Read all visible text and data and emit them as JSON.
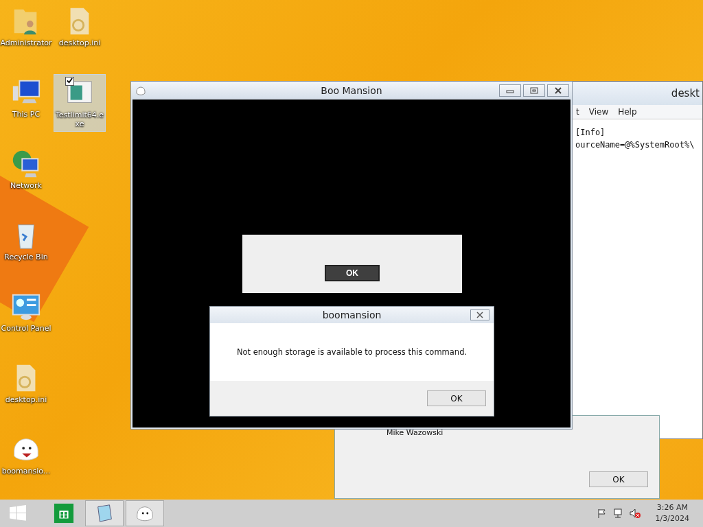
{
  "desktop_icons": [
    {
      "label": "Administrator",
      "kind": "user-folder",
      "selected": false
    },
    {
      "label": "This PC",
      "kind": "computer",
      "selected": false
    },
    {
      "label": "Network",
      "kind": "network",
      "selected": false
    },
    {
      "label": "Recycle Bin",
      "kind": "recycle",
      "selected": false
    },
    {
      "label": "Control Panel",
      "kind": "control",
      "selected": false
    },
    {
      "label": "desktop.ini",
      "kind": "settings-file",
      "selected": false
    },
    {
      "label": "boomansio...",
      "kind": "ghost",
      "selected": false
    },
    {
      "label": "desktop.ini",
      "kind": "settings-file",
      "selected": false
    },
    {
      "label": "Testlimit64.exe",
      "kind": "app",
      "selected": true,
      "checked": true
    }
  ],
  "notepad": {
    "title": "deskt",
    "menu": [
      "t",
      "View",
      "Help"
    ],
    "lines": [
      "[Info]",
      "ourceName=@%SystemRoot%\\"
    ]
  },
  "back_dialog": {
    "text": "Mike Wazowski",
    "button": "OK"
  },
  "game_window": {
    "title": "Boo Mansion",
    "dialog_button": "OK"
  },
  "message_box": {
    "title": "boomansion",
    "message": "Not enough storage is available to process this command.",
    "button": "OK"
  },
  "taskbar": {
    "apps": [
      {
        "kind": "store",
        "active": false
      },
      {
        "kind": "notepad",
        "active": true
      },
      {
        "kind": "ghost",
        "active": true
      }
    ],
    "time": "3:26 AM",
    "date": "1/3/2024"
  }
}
